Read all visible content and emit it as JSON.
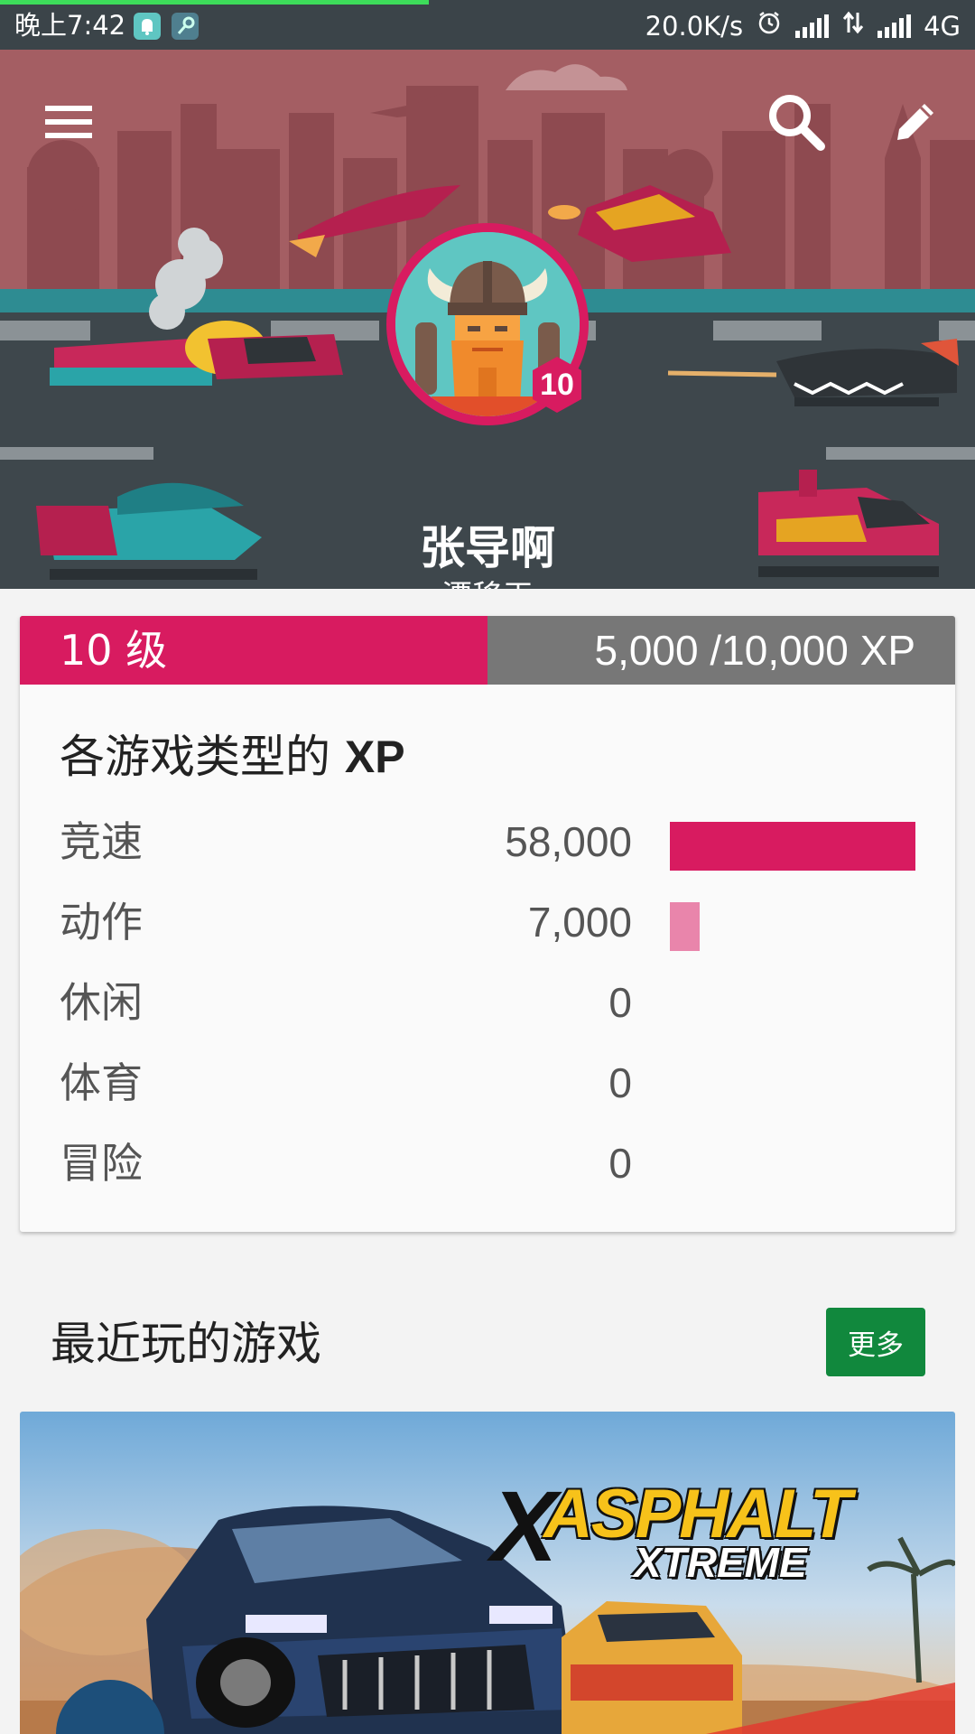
{
  "status_bar": {
    "time": "晚上7:42",
    "net_speed": "20.0K/s",
    "network": "4G",
    "icons": [
      "notification-bell-icon",
      "key-icon",
      "alarm-icon",
      "signal-icon",
      "data-arrows-icon",
      "signal-icon"
    ]
  },
  "header": {
    "menu_icon": "hamburger-menu-icon",
    "search_icon": "search-icon",
    "edit_icon": "pencil-edit-icon",
    "player_name": "张导啊",
    "player_title": "漂移王",
    "avatar": "viking-avatar",
    "avatar_level": "10"
  },
  "xp_card": {
    "level_label": "10 级",
    "xp_progress": "5,000 /10,000 XP",
    "xp_progress_fraction": 0.5,
    "section_title_cn": "各游戏类型的",
    "section_title_xp": "XP",
    "genres": [
      {
        "name": "竞速",
        "value": "58,000",
        "xp": 58000,
        "bar_color": "#d81b60"
      },
      {
        "name": "动作",
        "value": "7,000",
        "xp": 7000,
        "bar_color": "#e985ab"
      },
      {
        "name": "休闲",
        "value": "0",
        "xp": 0,
        "bar_color": "#d81b60"
      },
      {
        "name": "体育",
        "value": "0",
        "xp": 0,
        "bar_color": "#d81b60"
      },
      {
        "name": "冒险",
        "value": "0",
        "xp": 0,
        "bar_color": "#d81b60"
      }
    ],
    "max_xp": 58000
  },
  "recent": {
    "title": "最近玩的游戏",
    "more_label": "更多",
    "game_logo_line1": "ASPHALT",
    "game_logo_line2": "XTREME"
  },
  "colors": {
    "accent": "#d81b60",
    "more_button": "#11883d",
    "status_bar": "#3b4449"
  }
}
